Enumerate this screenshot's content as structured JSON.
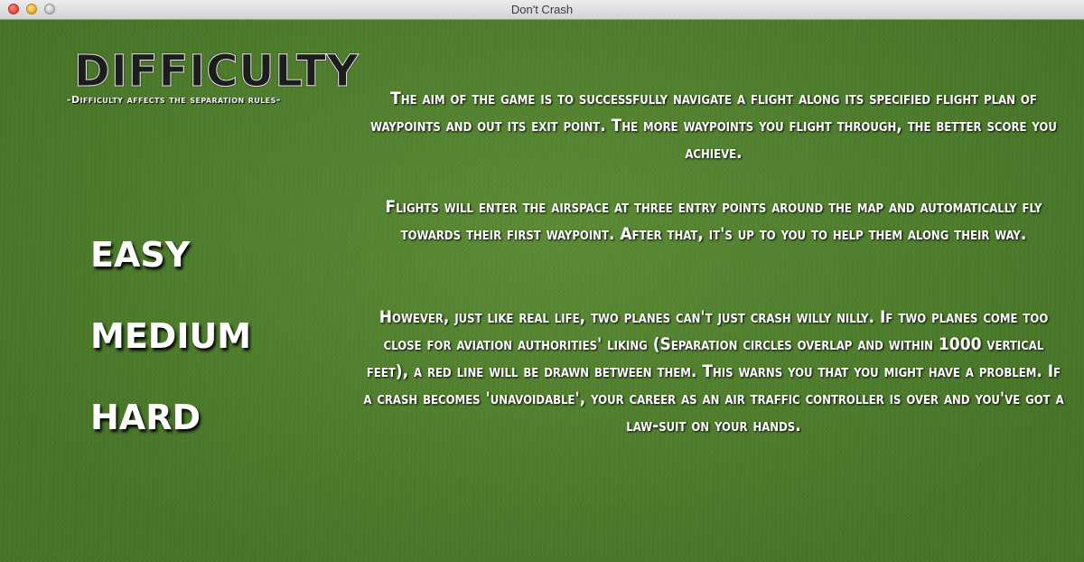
{
  "window": {
    "title": "Don't Crash"
  },
  "header": {
    "logo": "DIFFICULTY",
    "subtitle": "-Difficulty affects the separation rules-"
  },
  "difficulty_options": [
    "EASY",
    "MEDIUM",
    "HARD"
  ],
  "info": {
    "p1": "The aim of the game is to successfully navigate a flight along its specified flight plan of waypoints and out its exit point. The more waypoints you flight through, the better score you achieve.",
    "p2": "Flights will enter the airspace at three entry points around the map and automatically fly towards their first waypoint. After that, it's up to you to help them along their way.",
    "p3": "However, just like real life, two planes can't just crash willy nilly. If two planes come too close for aviation authorities' liking (Separation circles overlap and within 1000 vertical feet), a red line will be drawn between them. This warns you that you might have a problem. If a crash becomes 'unavoidable', your career as an air traffic controller is over and you've got a law-suit on your hands."
  },
  "colors": {
    "grass": "#4f7f2c",
    "text": "#ffffff",
    "logo_fill": "#1d1d1d"
  }
}
